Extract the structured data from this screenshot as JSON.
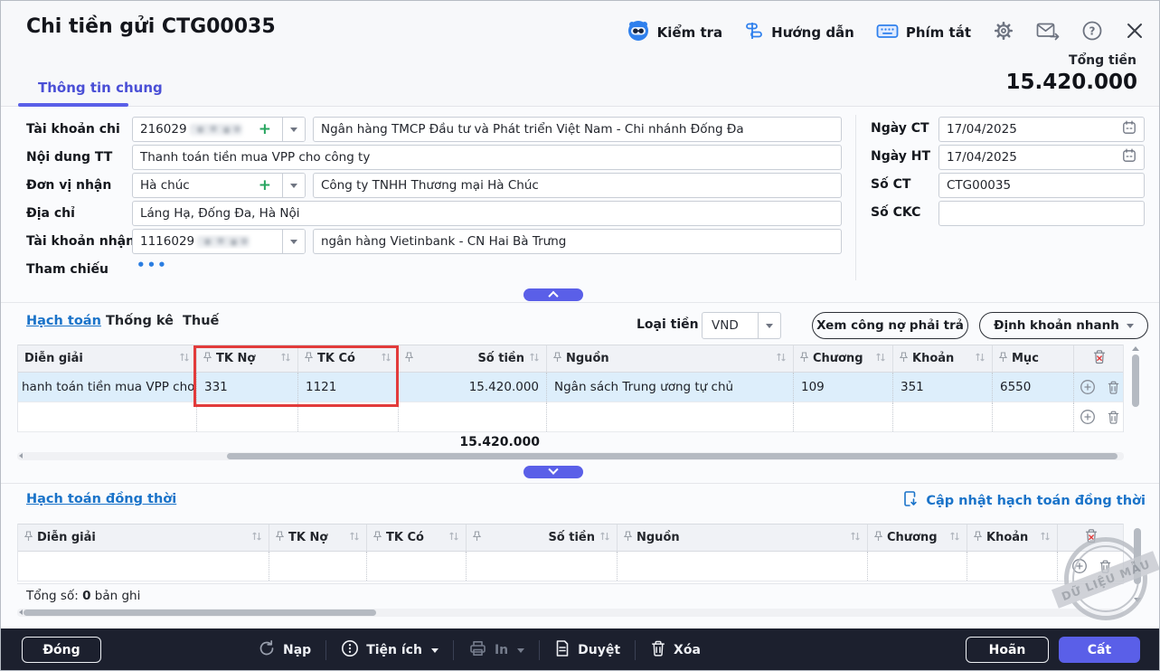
{
  "colors": {
    "accent": "#5a5fe8",
    "link": "#1a73c9",
    "highlight": "#e23b3b",
    "footer_bg": "#1c202e",
    "selected_row": "#ddeefb"
  },
  "header": {
    "title": "Chi tiền gửi CTG00035",
    "check_label": "Kiểm tra",
    "guide_label": "Hướng dẫn",
    "shortcut_label": "Phím tắt",
    "total_label": "Tổng tiền",
    "total_value": "15.420.000",
    "tab_general": "Thông tin chung"
  },
  "form": {
    "account_out": {
      "label": "Tài khoản chi",
      "value": "216029",
      "bank": "Ngân hàng TMCP Đầu tư và Phát triển Việt Nam - Chi nhánh Đống Đa"
    },
    "content": {
      "label": "Nội dung TT",
      "value": "Thanh toán tiền mua VPP cho công ty"
    },
    "receiver": {
      "label": "Đơn vị nhận",
      "value": "Hà chúc",
      "company": "Công ty TNHH Thương mại Hà Chúc"
    },
    "address": {
      "label": "Địa chỉ",
      "value": "Láng Hạ, Đống Đa, Hà Nội"
    },
    "account_in": {
      "label": "Tài khoản nhận",
      "value": "1116029",
      "bank": "ngân hàng Vietinbank - CN Hai Bà Trưng"
    },
    "reference": {
      "label": "Tham chiếu",
      "value": "•••"
    },
    "doc_date": {
      "label": "Ngày CT",
      "value": "17/04/2025"
    },
    "post_date": {
      "label": "Ngày HT",
      "value": "17/04/2025"
    },
    "doc_no": {
      "label": "Số CT",
      "value": "CTG00035"
    },
    "check_no": {
      "label": "Số CKC",
      "value": ""
    }
  },
  "detail": {
    "tabs": [
      "Hạch toán",
      "Thống kê",
      "Thuế"
    ],
    "currency_label": "Loại tiền",
    "currency_value": "VND",
    "debt_button": "Xem công nợ phải trả",
    "quick_button": "Định khoản nhanh",
    "columns": [
      "Diễn giải",
      "TK Nợ",
      "TK Có",
      "Số tiền",
      "Nguồn",
      "Chương",
      "Khoản",
      "Mục"
    ],
    "row": {
      "description": "hanh toán tiền mua VPP cho...",
      "debit": "331",
      "credit": "1121",
      "amount": "15.420.000",
      "source": "Ngân sách Trung ương tự chủ",
      "chapter": "109",
      "clause": "351",
      "item": "6550"
    },
    "total": "15.420.000"
  },
  "concurrent": {
    "title": "Hạch toán đồng thời",
    "update_link": "Cập nhật hạch toán đồng thời",
    "columns": [
      "Diễn giải",
      "TK Nợ",
      "TK Có",
      "Số tiền",
      "Nguồn",
      "Chương",
      "Khoản"
    ],
    "summary_label": "Tổng số:",
    "summary_count": "0",
    "summary_suffix": "bản ghi",
    "watermark": "DỮ LIỆU MẪU"
  },
  "footer": {
    "close": "Đóng",
    "reload": "Nạp",
    "utilities": "Tiện ích",
    "print": "In",
    "approve": "Duyệt",
    "delete": "Xóa",
    "postpone": "Hoãn",
    "save": "Cất"
  }
}
